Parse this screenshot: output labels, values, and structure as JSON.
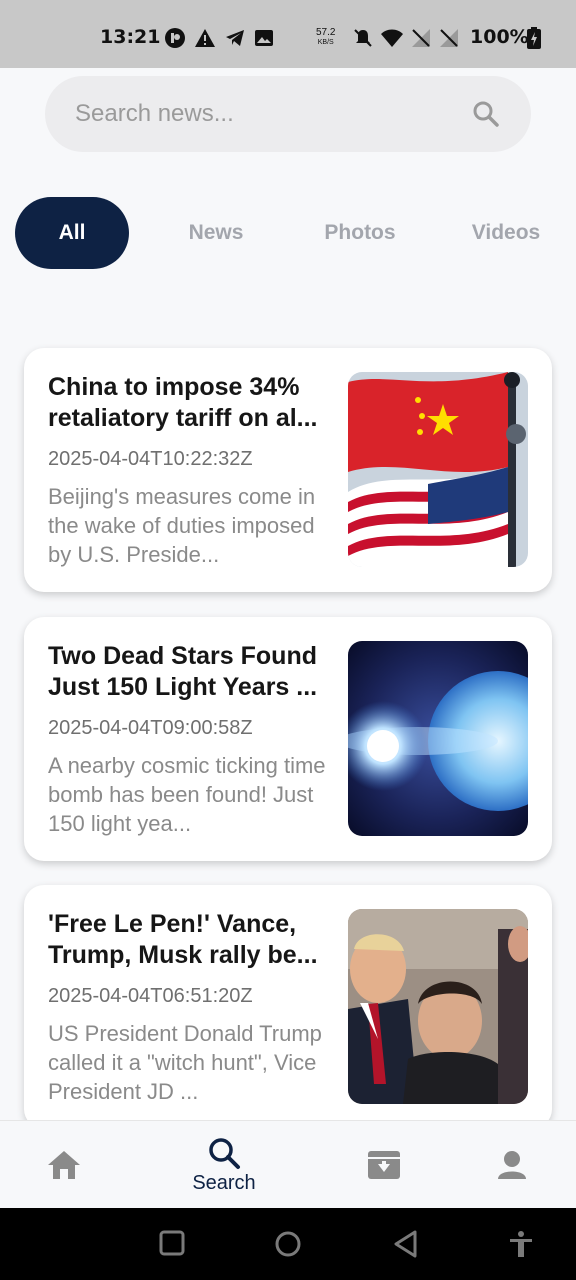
{
  "status_bar": {
    "time": "13:21",
    "net_speed_value": "57.2",
    "net_speed_unit": "KB/S",
    "battery": "100%"
  },
  "search": {
    "placeholder": "Search news..."
  },
  "tabs": [
    {
      "label": "All",
      "active": true
    },
    {
      "label": "News",
      "active": false
    },
    {
      "label": "Photos",
      "active": false
    },
    {
      "label": "Videos",
      "active": false
    }
  ],
  "articles": [
    {
      "title": "China to impose 34% retaliatory tariff on al...",
      "date": "2025-04-04T10:22:32Z",
      "description": "Beijing's measures come in the wake of duties imposed by U.S. Preside..."
    },
    {
      "title": "Two Dead Stars Found Just 150 Light Years ...",
      "date": "2025-04-04T09:00:58Z",
      "description": "A nearby cosmic ticking time bomb has been found! Just 150 light yea..."
    },
    {
      "title": "'Free Le Pen!' Vance, Trump, Musk rally be...",
      "date": "2025-04-04T06:51:20Z",
      "description": "US President Donald Trump called it a \"witch hunt\", Vice President JD ..."
    }
  ],
  "bottom_nav": {
    "home_icon": "home-icon",
    "search_label": "Search",
    "archive_icon": "archive-icon",
    "profile_icon": "person-icon",
    "active_color": "#0e2244",
    "inactive_color": "#8a8a8a"
  },
  "colors": {
    "accent": "#0e2244",
    "background": "#f7f8fa"
  }
}
